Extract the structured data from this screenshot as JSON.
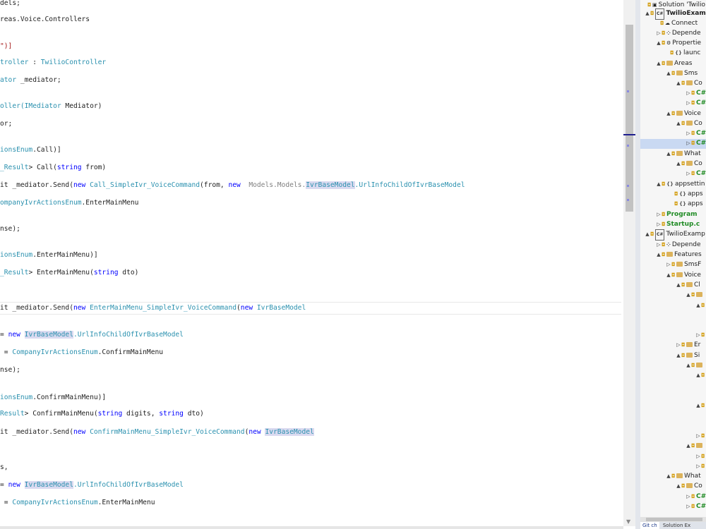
{
  "editor": {
    "lines": [
      [
        {
          "t": "dels;"
        }
      ],
      [
        {
          "t": "reas.Voice.Controllers"
        }
      ],
      [
        {
          "t": "\")]",
          "c": "str"
        }
      ],
      [
        {
          "t": "troller",
          "c": "ty"
        },
        {
          "t": " : "
        },
        {
          "t": "TwilioController",
          "c": "ty"
        }
      ],
      [
        {
          "t": "ator",
          "c": "ty"
        },
        {
          "t": " _mediator;"
        }
      ],
      [
        {
          "t": "oller(",
          "c": "ty"
        },
        {
          "t": "IMediator",
          "c": "ty"
        },
        {
          "t": " Mediator)"
        }
      ],
      [
        {
          "t": "or;"
        }
      ],
      [
        {
          "t": "ionsEnum",
          "c": "ty"
        },
        {
          "t": ".Call)]"
        }
      ],
      [
        {
          "t": "_Result",
          "c": "ty"
        },
        {
          "t": "> Call("
        },
        {
          "t": "string",
          "c": "kw"
        },
        {
          "t": " from)"
        }
      ],
      [
        {
          "t": "it _mediator.Send("
        },
        {
          "t": "new",
          "c": "kw"
        },
        {
          "t": " "
        },
        {
          "t": "Call_SimpleIvr_VoiceCommand",
          "c": "ty"
        },
        {
          "t": "(from, "
        },
        {
          "t": "new",
          "c": "kw"
        },
        {
          "t": "  "
        },
        {
          "t": "Models.Models.",
          "c": "gr"
        },
        {
          "t": "IvrBaseModel",
          "c": "ty hl"
        },
        {
          "t": ".UrlInfoChildOfIvrBaseModel",
          "c": "ty"
        }
      ],
      [
        {
          "t": "ompanyIvrActionsEnum",
          "c": "ty"
        },
        {
          "t": ".EnterMainMenu"
        }
      ],
      [
        {
          "t": "nse);"
        }
      ],
      [
        {
          "t": "ionsEnum",
          "c": "ty"
        },
        {
          "t": ".EnterMainMenu)]"
        }
      ],
      [
        {
          "t": "_Result",
          "c": "ty"
        },
        {
          "t": "> EnterMainMenu("
        },
        {
          "t": "string",
          "c": "kw"
        },
        {
          "t": " dto)"
        }
      ],
      [
        {
          "t": "it _mediator.Send("
        },
        {
          "t": "new",
          "c": "kw"
        },
        {
          "t": " "
        },
        {
          "t": "EnterMainMenu_SimpleIvr_VoiceCommand",
          "c": "ty"
        },
        {
          "t": "("
        },
        {
          "t": "new",
          "c": "kw"
        },
        {
          "t": " "
        },
        {
          "t": "IvrBaseModel",
          "c": "ty"
        }
      ],
      [
        {
          "t": "= "
        },
        {
          "t": "new",
          "c": "kw"
        },
        {
          "t": " "
        },
        {
          "t": "IvrBaseModel",
          "c": "ty hl"
        },
        {
          "t": ".UrlInfoChildOfIvrBaseModel",
          "c": "ty"
        }
      ],
      [
        {
          "t": " = "
        },
        {
          "t": "CompanyIvrActionsEnum",
          "c": "ty"
        },
        {
          "t": ".ConfirmMainMenu"
        }
      ],
      [
        {
          "t": "nse);"
        }
      ],
      [
        {
          "t": "ionsEnum",
          "c": "ty"
        },
        {
          "t": ".ConfirmMainMenu)]"
        }
      ],
      [
        {
          "t": "Result",
          "c": "ty"
        },
        {
          "t": "> ConfirmMainMenu("
        },
        {
          "t": "string",
          "c": "kw"
        },
        {
          "t": " digits, "
        },
        {
          "t": "string",
          "c": "kw"
        },
        {
          "t": " dto)"
        }
      ],
      [
        {
          "t": "it _mediator.Send("
        },
        {
          "t": "new",
          "c": "kw"
        },
        {
          "t": " "
        },
        {
          "t": "ConfirmMainMenu_SimpleIvr_VoiceCommand",
          "c": "ty"
        },
        {
          "t": "("
        },
        {
          "t": "new",
          "c": "kw"
        },
        {
          "t": " "
        },
        {
          "t": "IvrBaseModel",
          "c": "ty hl"
        }
      ],
      [
        {
          "t": "s,"
        }
      ],
      [
        {
          "t": "= "
        },
        {
          "t": "new",
          "c": "kw"
        },
        {
          "t": " "
        },
        {
          "t": "IvrBaseModel",
          "c": "ty hl"
        },
        {
          "t": ".UrlInfoChildOfIvrBaseModel",
          "c": "ty"
        }
      ],
      [
        {
          "t": " = "
        },
        {
          "t": "CompanyIvrActionsEnum",
          "c": "ty"
        },
        {
          "t": ".EnterMainMenu"
        }
      ]
    ]
  },
  "solution_explorer": {
    "nodes": [
      {
        "label": "Solution 'Twilio",
        "icon": "solution-icon",
        "twisty": ""
      },
      {
        "label": "TwilioExamp",
        "icon": "project-icon",
        "twisty": "▲",
        "bold": true
      },
      {
        "label": "Connect",
        "icon": "connected-services-icon",
        "twisty": ""
      },
      {
        "label": "Depende",
        "icon": "dependencies-icon",
        "twisty": "▷"
      },
      {
        "label": "Propertie",
        "icon": "properties-icon",
        "twisty": "▲"
      },
      {
        "label": "launc",
        "icon": "json-icon",
        "twisty": ""
      },
      {
        "label": "Areas",
        "icon": "folder-icon",
        "twisty": "▲"
      },
      {
        "label": "Sms",
        "icon": "folder-icon",
        "twisty": "▲"
      },
      {
        "label": "Co",
        "icon": "folder-icon",
        "twisty": "▲"
      },
      {
        "label": "C#",
        "icon": "csharp-icon",
        "twisty": "▷"
      },
      {
        "label": "C#",
        "icon": "csharp-icon",
        "twisty": "▷"
      },
      {
        "label": "Voice",
        "icon": "folder-icon",
        "twisty": "▲"
      },
      {
        "label": "Co",
        "icon": "folder-icon",
        "twisty": "▲"
      },
      {
        "label": "C#",
        "icon": "csharp-icon",
        "twisty": "▷"
      },
      {
        "label": "C#",
        "icon": "csharp-icon",
        "twisty": "▷"
      },
      {
        "label": "What",
        "icon": "folder-icon",
        "twisty": "▲"
      },
      {
        "label": "Co",
        "icon": "folder-icon",
        "twisty": "▲"
      },
      {
        "label": "C#",
        "icon": "csharp-icon",
        "twisty": "▷"
      },
      {
        "label": "appsettin",
        "icon": "json-icon",
        "twisty": "▲"
      },
      {
        "label": "apps",
        "icon": "json-icon",
        "twisty": ""
      },
      {
        "label": "apps",
        "icon": "json-icon",
        "twisty": ""
      },
      {
        "label": "Program",
        "icon": "csharp-icon",
        "twisty": "▷"
      },
      {
        "label": "Startup.c",
        "icon": "csharp-icon",
        "twisty": "▷"
      },
      {
        "label": "TwilioExamp",
        "icon": "project-icon",
        "twisty": "▲"
      },
      {
        "label": "Depende",
        "icon": "dependencies-icon",
        "twisty": "▷"
      },
      {
        "label": "Features",
        "icon": "folder-icon",
        "twisty": "▲"
      },
      {
        "label": "SmsF",
        "icon": "folder-icon",
        "twisty": "▷"
      },
      {
        "label": "Voice",
        "icon": "folder-icon",
        "twisty": "▲"
      },
      {
        "label": "Cl",
        "icon": "folder-icon",
        "twisty": "▲"
      },
      {
        "label": "",
        "icon": "folder-icon",
        "twisty": "▲"
      },
      {
        "label": "",
        "icon": "folder-icon",
        "twisty": "▲"
      },
      {
        "label": "",
        "icon": "blank",
        "twisty": ""
      },
      {
        "label": "",
        "icon": "blank",
        "twisty": ""
      },
      {
        "label": "",
        "icon": "folder-icon",
        "twisty": "▷"
      },
      {
        "label": "Er",
        "icon": "folder-icon",
        "twisty": "▷"
      },
      {
        "label": "Si",
        "icon": "folder-icon",
        "twisty": "▲"
      },
      {
        "label": "",
        "icon": "folder-icon",
        "twisty": "▲"
      },
      {
        "label": "",
        "icon": "folder-icon",
        "twisty": "▲"
      },
      {
        "label": "",
        "icon": "blank",
        "twisty": ""
      },
      {
        "label": "",
        "icon": "blank",
        "twisty": ""
      },
      {
        "label": "",
        "icon": "folder-icon",
        "twisty": "▲"
      },
      {
        "label": "",
        "icon": "blank",
        "twisty": ""
      },
      {
        "label": "",
        "icon": "blank",
        "twisty": ""
      },
      {
        "label": "",
        "icon": "folder-icon",
        "twisty": "▷"
      },
      {
        "label": "",
        "icon": "folder-icon",
        "twisty": "▲"
      },
      {
        "label": "",
        "icon": "folder-icon",
        "twisty": "▷"
      },
      {
        "label": "",
        "icon": "folder-icon",
        "twisty": "▷"
      },
      {
        "label": "What",
        "icon": "folder-icon",
        "twisty": "▲"
      },
      {
        "label": "Co",
        "icon": "folder-icon",
        "twisty": "▲"
      },
      {
        "label": "C#",
        "icon": "csharp-icon",
        "twisty": "▷"
      },
      {
        "label": "C#",
        "icon": "csharp-icon",
        "twisty": "▷"
      }
    ],
    "tabs": [
      "Git ch",
      "Solution Ex"
    ]
  },
  "colors": {
    "keyword": "#0000ff",
    "type": "#2b91af",
    "selection": "#c9d9f2",
    "highlight": "#dadaf0"
  }
}
